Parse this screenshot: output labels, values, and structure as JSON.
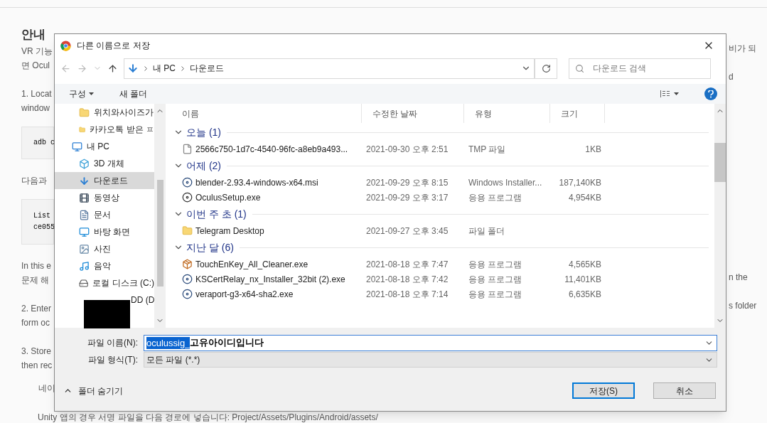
{
  "page": {
    "left_fragments": [
      {
        "kind": "heading",
        "text": "안내"
      },
      {
        "kind": "text",
        "text": "VR 기능"
      },
      {
        "kind": "text",
        "text": "면 Ocul"
      },
      {
        "kind": "gap",
        "text": "1. Locat"
      },
      {
        "kind": "text",
        "text": "window"
      },
      {
        "kind": "code",
        "text": "adb c"
      },
      {
        "kind": "gap",
        "text": "다음과"
      },
      {
        "kind": "code2",
        "text": "List\nce055"
      },
      {
        "kind": "gap",
        "text": "In this e"
      },
      {
        "kind": "text",
        "text": "문제 해"
      },
      {
        "kind": "gap",
        "text": "2. Enter"
      },
      {
        "kind": "text",
        "text": "form oc"
      },
      {
        "kind": "gap",
        "text": "3. Store"
      },
      {
        "kind": "text",
        "text": "then rec"
      },
      {
        "kind": "indent",
        "text": "네이"
      }
    ],
    "right_fragments": [
      {
        "kind": "text",
        "text": "비가 되"
      },
      {
        "kind": "gap",
        "text": "d"
      },
      {
        "kind": "far",
        "text": "n the"
      },
      {
        "kind": "gap",
        "text": "s folder"
      }
    ],
    "bottom_line": "Unity 앱의 경우 서명 파일을 다음 경로에 넣습니다: Project/Assets/Plugins/Android/assets/"
  },
  "dialog": {
    "title": "다른 이름으로 저장",
    "breadcrumb": [
      "내 PC",
      "다운로드"
    ],
    "search": {
      "placeholder": "다운로드 검색"
    },
    "toolbar": {
      "organize": "구성",
      "new_folder": "새 폴더"
    },
    "nav_items": [
      {
        "kind": "folder",
        "label": "위치와사이즈가",
        "selected": false
      },
      {
        "kind": "folder",
        "label": "카카오톡 받은 ㅍ",
        "selected": false
      },
      {
        "kind": "pc",
        "label": "내 PC",
        "selected": false,
        "children": [
          {
            "kind": "cube",
            "label": "3D 개체",
            "selected": false
          },
          {
            "kind": "download",
            "label": "다운로드",
            "selected": true
          },
          {
            "kind": "video",
            "label": "동영상",
            "selected": false
          },
          {
            "kind": "document",
            "label": "문서",
            "selected": false
          },
          {
            "kind": "desktop",
            "label": "바탕 화면",
            "selected": false
          },
          {
            "kind": "picture",
            "label": "사진",
            "selected": false
          },
          {
            "kind": "music",
            "label": "음악",
            "selected": false
          },
          {
            "kind": "disk",
            "label": "로컬 디스크 (C:)",
            "selected": false
          },
          {
            "kind": "drive",
            "label": "DD (D",
            "selected": false
          }
        ]
      }
    ],
    "columns": [
      "이름",
      "수정한 날짜",
      "유형",
      "크기"
    ],
    "groups": [
      {
        "label": "오늘 (1)",
        "expanded": true,
        "files": [
          {
            "kind": "tmp",
            "name": "2566c750-1d7c-4540-96fc-a8eb9a493...",
            "date": "2021-09-30 오후 2:51",
            "type": "TMP 파일",
            "size": "1KB"
          }
        ]
      },
      {
        "label": "어제 (2)",
        "expanded": true,
        "files": [
          {
            "kind": "installer",
            "name": "blender-2.93.4-windows-x64.msi",
            "date": "2021-09-29 오후 8:15",
            "type": "Windows Installer...",
            "size": "187,140KB"
          },
          {
            "kind": "app",
            "name": "OculusSetup.exe",
            "date": "2021-09-29 오후 3:17",
            "type": "응용 프로그램",
            "size": "4,954KB"
          }
        ]
      },
      {
        "label": "이번 주 초 (1)",
        "expanded": true,
        "files": [
          {
            "kind": "folder",
            "name": "Telegram Desktop",
            "date": "2021-09-27 오후 3:45",
            "type": "파일 폴더"
          }
        ]
      },
      {
        "label": "지난 달 (6)",
        "expanded": true,
        "files": [
          {
            "kind": "box",
            "name": "TouchEnKey_All_Cleaner.exe",
            "date": "2021-08-18 오후 7:47",
            "type": "응용 프로그램",
            "size": "4,565KB"
          },
          {
            "kind": "installer",
            "name": "KSCertRelay_nx_Installer_32bit (2).exe",
            "date": "2021-08-18 오후 7:42",
            "type": "응용 프로그램",
            "size": "11,401KB"
          },
          {
            "kind": "installer",
            "name": "veraport-g3-x64-sha2.exe",
            "date": "2021-08-18 오후 7:14",
            "type": "응용 프로그램",
            "size": "6,635KB"
          }
        ]
      }
    ],
    "filename": {
      "label": "파일 이름(N):",
      "selected_text": "oculussig_",
      "rest_text": "고유아이디입니다"
    },
    "filetype": {
      "label": "파일 형식(T):",
      "value": "모든 파일 (*.*)"
    },
    "hide_folders": "폴더 숨기기",
    "buttons": [
      {
        "kind": "primary",
        "label": "저장(S)"
      },
      {
        "kind": "normal",
        "label": "취소"
      }
    ]
  }
}
